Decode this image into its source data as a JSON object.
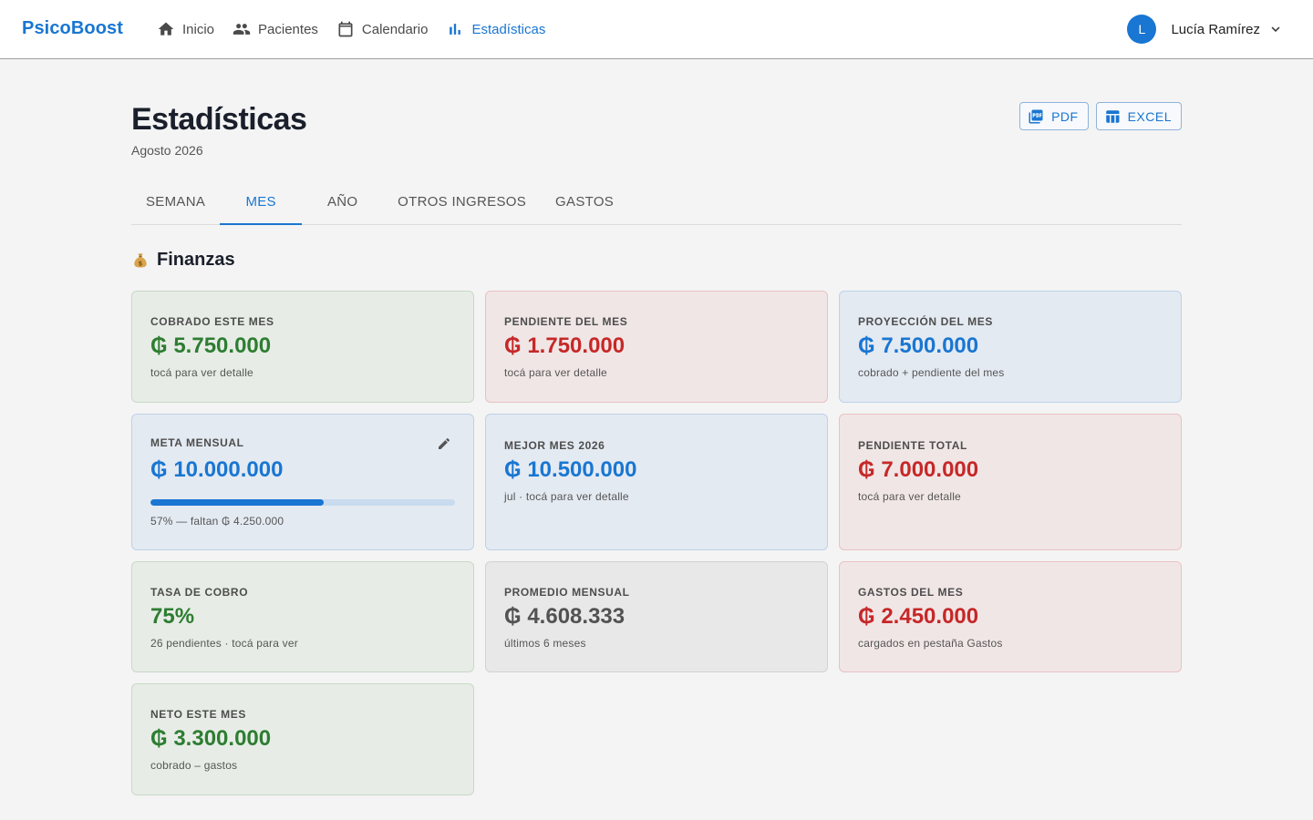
{
  "app": {
    "brand": "PsicoBoost"
  },
  "nav": {
    "items": [
      {
        "label": "Inicio",
        "icon": "home-icon"
      },
      {
        "label": "Pacientes",
        "icon": "people-icon"
      },
      {
        "label": "Calendario",
        "icon": "calendar-icon"
      },
      {
        "label": "Estadísticas",
        "icon": "bar-chart-icon",
        "active": true
      }
    ]
  },
  "user": {
    "initial": "L",
    "name": "Lucía Ramírez"
  },
  "header": {
    "title": "Estadísticas",
    "subtitle": "Agosto 2026"
  },
  "actions": {
    "pdf_label": "PDF",
    "excel_label": "EXCEL"
  },
  "tabs": [
    {
      "label": "SEMANA"
    },
    {
      "label": "MES",
      "active": true
    },
    {
      "label": "AÑO"
    },
    {
      "label": "OTROS INGRESOS"
    },
    {
      "label": "GASTOS"
    }
  ],
  "section": {
    "title": "Finanzas",
    "icon": "money-bag-icon"
  },
  "cards": {
    "cobrado": {
      "label": "COBRADO ESTE MES",
      "value": "₲ 5.750.000",
      "hint": "tocá para ver detalle"
    },
    "pendiente_mes": {
      "label": "PENDIENTE DEL MES",
      "value": "₲ 1.750.000",
      "hint": "tocá para ver detalle"
    },
    "proyeccion": {
      "label": "PROYECCIÓN DEL MES",
      "value": "₲ 7.500.000",
      "hint": "cobrado + pendiente del mes"
    },
    "meta": {
      "label": "META MENSUAL",
      "value": "₲ 10.000.000",
      "progress": 0.57,
      "hint": "57% — faltan ₲ 4.250.000"
    },
    "mejor_mes": {
      "label": "MEJOR MES 2026",
      "value": "₲ 10.500.000",
      "hint": "jul · tocá para ver detalle"
    },
    "pendiente_total": {
      "label": "PENDIENTE TOTAL",
      "value": "₲ 7.000.000",
      "hint": "tocá para ver detalle"
    },
    "tasa": {
      "label": "TASA DE COBRO",
      "value": "75%",
      "hint": "26 pendientes · tocá para ver"
    },
    "promedio": {
      "label": "PROMEDIO MENSUAL",
      "value": "₲ 4.608.333",
      "hint": "últimos 6 meses"
    },
    "gastos": {
      "label": "GASTOS DEL MES",
      "value": "₲ 2.450.000",
      "hint": "cargados en pestaña Gastos"
    },
    "neto": {
      "label": "NETO ESTE MES",
      "value": "₲ 3.300.000",
      "hint": "cobrado – gastos"
    }
  },
  "colors": {
    "accent": "#1976d2",
    "positive": "#2e7d32",
    "negative": "#c62828",
    "neutral": "#525252"
  }
}
